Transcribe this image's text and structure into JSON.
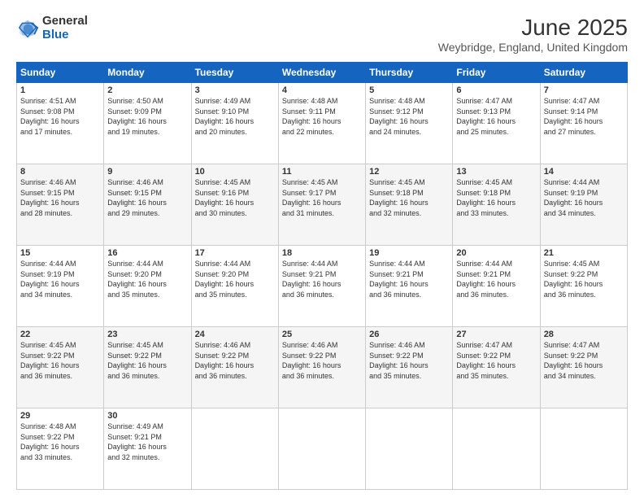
{
  "header": {
    "logo_line1": "General",
    "logo_line2": "Blue",
    "month_year": "June 2025",
    "location": "Weybridge, England, United Kingdom"
  },
  "days_of_week": [
    "Sunday",
    "Monday",
    "Tuesday",
    "Wednesday",
    "Thursday",
    "Friday",
    "Saturday"
  ],
  "weeks": [
    [
      {
        "day": "1",
        "info": "Sunrise: 4:51 AM\nSunset: 9:08 PM\nDaylight: 16 hours\nand 17 minutes."
      },
      {
        "day": "2",
        "info": "Sunrise: 4:50 AM\nSunset: 9:09 PM\nDaylight: 16 hours\nand 19 minutes."
      },
      {
        "day": "3",
        "info": "Sunrise: 4:49 AM\nSunset: 9:10 PM\nDaylight: 16 hours\nand 20 minutes."
      },
      {
        "day": "4",
        "info": "Sunrise: 4:48 AM\nSunset: 9:11 PM\nDaylight: 16 hours\nand 22 minutes."
      },
      {
        "day": "5",
        "info": "Sunrise: 4:48 AM\nSunset: 9:12 PM\nDaylight: 16 hours\nand 24 minutes."
      },
      {
        "day": "6",
        "info": "Sunrise: 4:47 AM\nSunset: 9:13 PM\nDaylight: 16 hours\nand 25 minutes."
      },
      {
        "day": "7",
        "info": "Sunrise: 4:47 AM\nSunset: 9:14 PM\nDaylight: 16 hours\nand 27 minutes."
      }
    ],
    [
      {
        "day": "8",
        "info": "Sunrise: 4:46 AM\nSunset: 9:15 PM\nDaylight: 16 hours\nand 28 minutes."
      },
      {
        "day": "9",
        "info": "Sunrise: 4:46 AM\nSunset: 9:15 PM\nDaylight: 16 hours\nand 29 minutes."
      },
      {
        "day": "10",
        "info": "Sunrise: 4:45 AM\nSunset: 9:16 PM\nDaylight: 16 hours\nand 30 minutes."
      },
      {
        "day": "11",
        "info": "Sunrise: 4:45 AM\nSunset: 9:17 PM\nDaylight: 16 hours\nand 31 minutes."
      },
      {
        "day": "12",
        "info": "Sunrise: 4:45 AM\nSunset: 9:18 PM\nDaylight: 16 hours\nand 32 minutes."
      },
      {
        "day": "13",
        "info": "Sunrise: 4:45 AM\nSunset: 9:18 PM\nDaylight: 16 hours\nand 33 minutes."
      },
      {
        "day": "14",
        "info": "Sunrise: 4:44 AM\nSunset: 9:19 PM\nDaylight: 16 hours\nand 34 minutes."
      }
    ],
    [
      {
        "day": "15",
        "info": "Sunrise: 4:44 AM\nSunset: 9:19 PM\nDaylight: 16 hours\nand 34 minutes."
      },
      {
        "day": "16",
        "info": "Sunrise: 4:44 AM\nSunset: 9:20 PM\nDaylight: 16 hours\nand 35 minutes."
      },
      {
        "day": "17",
        "info": "Sunrise: 4:44 AM\nSunset: 9:20 PM\nDaylight: 16 hours\nand 35 minutes."
      },
      {
        "day": "18",
        "info": "Sunrise: 4:44 AM\nSunset: 9:21 PM\nDaylight: 16 hours\nand 36 minutes."
      },
      {
        "day": "19",
        "info": "Sunrise: 4:44 AM\nSunset: 9:21 PM\nDaylight: 16 hours\nand 36 minutes."
      },
      {
        "day": "20",
        "info": "Sunrise: 4:44 AM\nSunset: 9:21 PM\nDaylight: 16 hours\nand 36 minutes."
      },
      {
        "day": "21",
        "info": "Sunrise: 4:45 AM\nSunset: 9:22 PM\nDaylight: 16 hours\nand 36 minutes."
      }
    ],
    [
      {
        "day": "22",
        "info": "Sunrise: 4:45 AM\nSunset: 9:22 PM\nDaylight: 16 hours\nand 36 minutes."
      },
      {
        "day": "23",
        "info": "Sunrise: 4:45 AM\nSunset: 9:22 PM\nDaylight: 16 hours\nand 36 minutes."
      },
      {
        "day": "24",
        "info": "Sunrise: 4:46 AM\nSunset: 9:22 PM\nDaylight: 16 hours\nand 36 minutes."
      },
      {
        "day": "25",
        "info": "Sunrise: 4:46 AM\nSunset: 9:22 PM\nDaylight: 16 hours\nand 36 minutes."
      },
      {
        "day": "26",
        "info": "Sunrise: 4:46 AM\nSunset: 9:22 PM\nDaylight: 16 hours\nand 35 minutes."
      },
      {
        "day": "27",
        "info": "Sunrise: 4:47 AM\nSunset: 9:22 PM\nDaylight: 16 hours\nand 35 minutes."
      },
      {
        "day": "28",
        "info": "Sunrise: 4:47 AM\nSunset: 9:22 PM\nDaylight: 16 hours\nand 34 minutes."
      }
    ],
    [
      {
        "day": "29",
        "info": "Sunrise: 4:48 AM\nSunset: 9:22 PM\nDaylight: 16 hours\nand 33 minutes."
      },
      {
        "day": "30",
        "info": "Sunrise: 4:49 AM\nSunset: 9:21 PM\nDaylight: 16 hours\nand 32 minutes."
      },
      {
        "day": "",
        "info": ""
      },
      {
        "day": "",
        "info": ""
      },
      {
        "day": "",
        "info": ""
      },
      {
        "day": "",
        "info": ""
      },
      {
        "day": "",
        "info": ""
      }
    ]
  ]
}
